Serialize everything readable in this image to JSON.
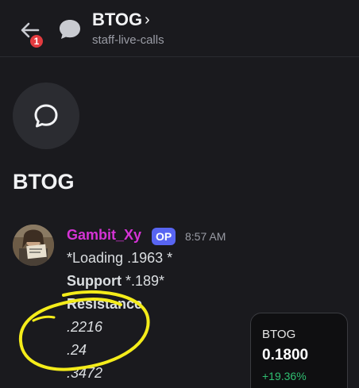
{
  "header": {
    "title": "BTOG",
    "chevron": "›",
    "subtitle": "staff-live-calls",
    "back_badge": "1"
  },
  "thread": {
    "name": "BTOG"
  },
  "message": {
    "author": "Gambit_Xy",
    "op_tag": "OP",
    "time": "8:57 AM",
    "lines": [
      "*Loading .1963 *",
      "Support",
      " *.189*",
      "Resistance",
      ".2216",
      ".24",
      ".3472"
    ]
  },
  "ticker": {
    "symbol": "BTOG",
    "price": "0.1800",
    "change": "+19.36%"
  },
  "colors": {
    "author": "#d633d6",
    "op_badge": "#5865f2",
    "badge_red": "#e23b3f",
    "positive": "#2fbf71",
    "annotation": "#f4ec1a"
  },
  "icons": [
    "back-arrow-icon",
    "thread-bubble-icon",
    "chat-bubble-icon",
    "chevron-right-icon"
  ]
}
